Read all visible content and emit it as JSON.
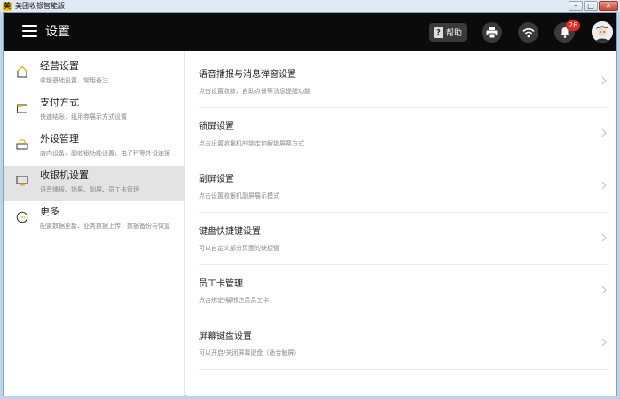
{
  "window": {
    "title": "美团收银智能版",
    "logo": "美"
  },
  "header": {
    "title": "设置",
    "help_label": "帮助",
    "notification_count": "26"
  },
  "icons": {
    "menu": "hamburger-icon",
    "help": "question-icon",
    "print": "printer-icon",
    "wifi": "wifi-icon",
    "bell": "bell-icon",
    "chevron": "chevron-right-icon"
  },
  "colors": {
    "header_bg": "#0b0b0b",
    "active_bg": "#e3e3e3",
    "badge": "#e22d24"
  },
  "sidebar": {
    "items": [
      {
        "label": "经营设置",
        "desc": "收银基础设置、常用备注"
      },
      {
        "label": "支付方式",
        "desc": "快速结账、纸用券展示方式设置"
      },
      {
        "label": "外设管理",
        "desc": "店内设备、副收银功能设置，电子秤等外设连接"
      },
      {
        "label": "收银机设置",
        "desc": "语音播报、锁屏、副屏、员工卡管理"
      },
      {
        "label": "更多",
        "desc": "配置数据更新、业务数据上传、数据备份与恢复"
      }
    ]
  },
  "main": {
    "rows": [
      {
        "title": "语音播报与消息弹窗设置",
        "desc": "点击设置收款、自助点餐等消息提醒功能"
      },
      {
        "title": "锁屏设置",
        "desc": "点击设置收银机的锁定和解锁屏幕方式"
      },
      {
        "title": "副屏设置",
        "desc": "点击设置收银机副屏展示模式"
      },
      {
        "title": "键盘快捷键设置",
        "desc": "可以自定义部分页面的快捷键"
      },
      {
        "title": "员工卡管理",
        "desc": "点击绑定/解绑店员员工卡"
      },
      {
        "title": "屏幕键盘设置",
        "desc": "可以开启/关闭屏幕键盘（适合触屏）"
      }
    ]
  }
}
